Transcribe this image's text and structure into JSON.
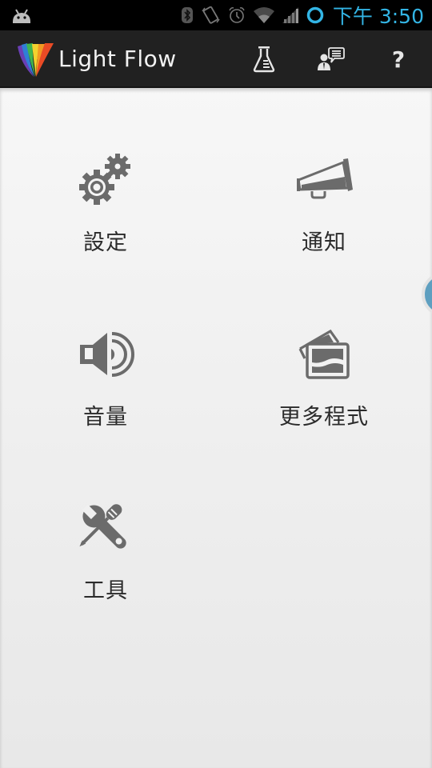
{
  "status_bar": {
    "time": "下午 3:50",
    "icons": [
      "android-debug-icon",
      "bluetooth-icon",
      "vibrate-icon",
      "alarm-icon",
      "wifi-icon",
      "signal-icon",
      "sync-ring-icon"
    ],
    "accent_color": "#33b5e5"
  },
  "action_bar": {
    "title": "Light Flow",
    "actions": [
      {
        "name": "lab-flask",
        "icon": "flask-icon"
      },
      {
        "name": "support",
        "icon": "support-chat-icon"
      },
      {
        "name": "help",
        "icon": "help-icon",
        "glyph": "?"
      }
    ]
  },
  "menu": {
    "items": [
      {
        "id": "settings",
        "label": "設定",
        "icon": "gears-icon"
      },
      {
        "id": "notifications",
        "label": "通知",
        "icon": "megaphone-icon"
      },
      {
        "id": "volume",
        "label": "音量",
        "icon": "speaker-icon"
      },
      {
        "id": "more-apps",
        "label": "更多程式",
        "icon": "cards-icon"
      },
      {
        "id": "tools",
        "label": "工具",
        "icon": "tools-icon"
      }
    ]
  },
  "colors": {
    "icon_gray": "#6b6b6b",
    "action_bar_bg": "#212121",
    "edge_handle": "#5e9fc0"
  }
}
